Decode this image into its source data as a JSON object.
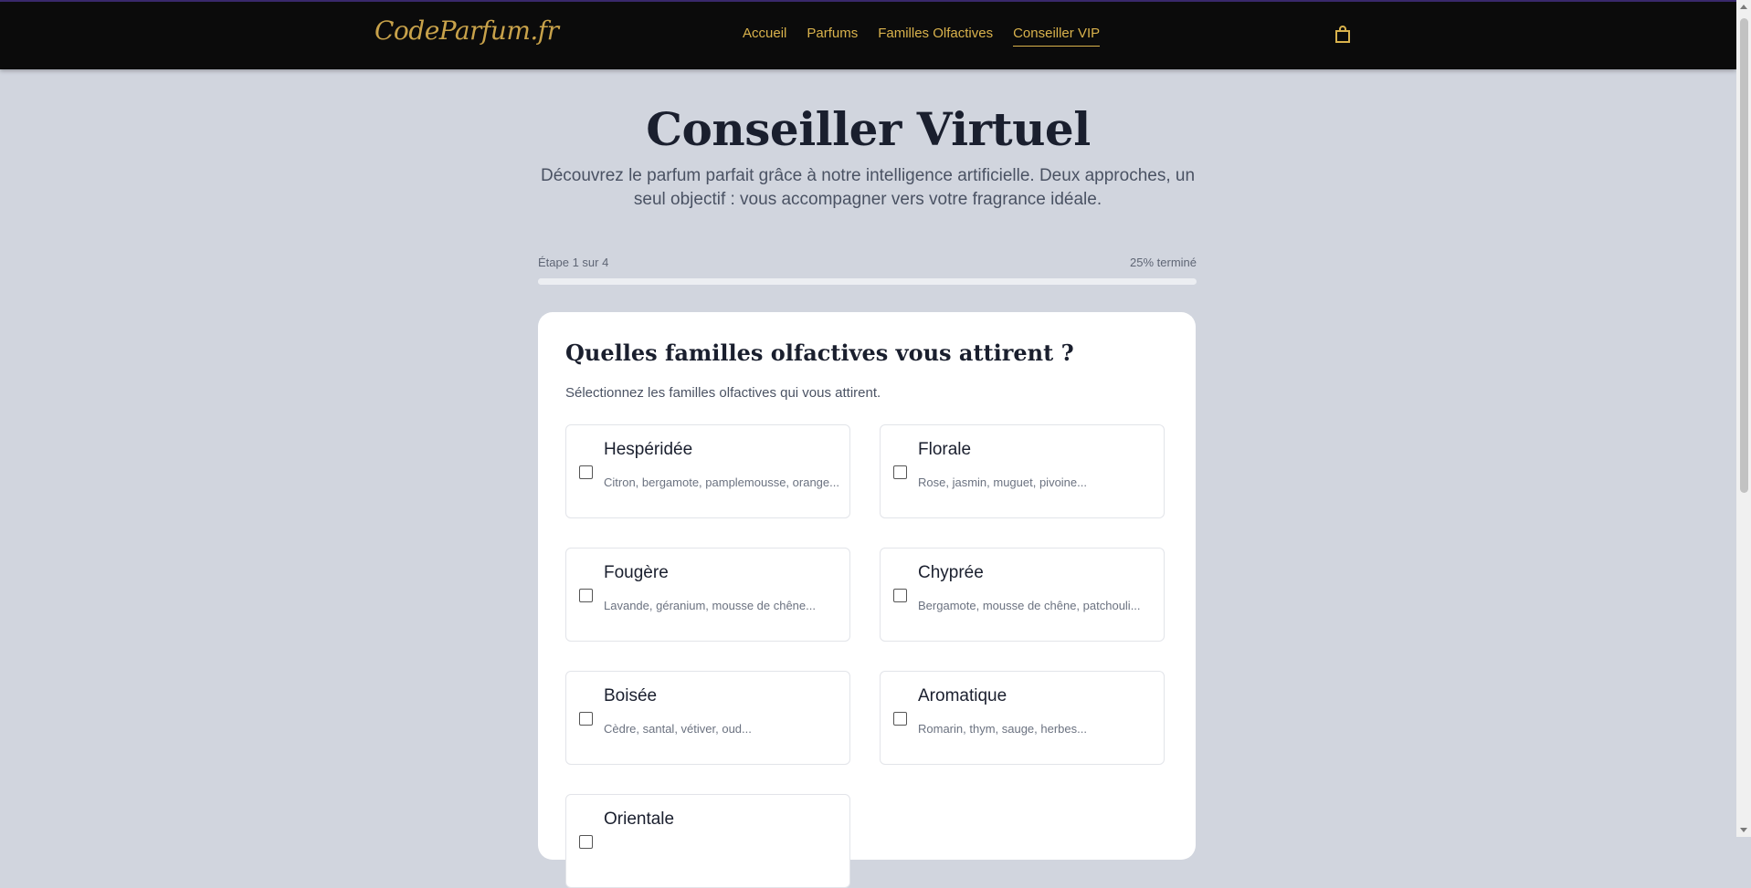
{
  "header": {
    "logo": "CodeParfum.fr",
    "nav": [
      {
        "label": "Accueil",
        "active": false
      },
      {
        "label": "Parfums",
        "active": false
      },
      {
        "label": "Familles Olfactives",
        "active": false
      },
      {
        "label": "Conseiller VIP",
        "active": true
      }
    ],
    "cart_icon": "shopping-bag-icon",
    "accent_color": "#d9b24c"
  },
  "hero": {
    "title": "Conseiller Virtuel",
    "subtitle": "Découvrez le parfum parfait grâce à notre intelligence artificielle. Deux approches, un seul objectif : vous accompagner vers votre fragrance idéale."
  },
  "progress": {
    "step_label": "Étape 1 sur 4",
    "percent_label": "25% terminé",
    "value": 0.25
  },
  "question": {
    "title": "Quelles familles olfactives vous attirent ?",
    "subtitle": "Sélectionnez les familles olfactives qui vous attirent.",
    "options": [
      {
        "title": "Hespéridée",
        "desc": "Citron, bergamote, pamplemousse, orange...",
        "checked": false
      },
      {
        "title": "Florale",
        "desc": "Rose, jasmin, muguet, pivoine...",
        "checked": false
      },
      {
        "title": "Fougère",
        "desc": "Lavande, géranium, mousse de chêne...",
        "checked": false
      },
      {
        "title": "Chyprée",
        "desc": "Bergamote, mousse de chêne, patchouli...",
        "checked": false
      },
      {
        "title": "Boisée",
        "desc": "Cèdre, santal, vétiver, oud...",
        "checked": false
      },
      {
        "title": "Aromatique",
        "desc": "Romarin, thym, sauge, herbes...",
        "checked": false
      },
      {
        "title": "Orientale",
        "desc": "",
        "checked": false
      }
    ]
  }
}
